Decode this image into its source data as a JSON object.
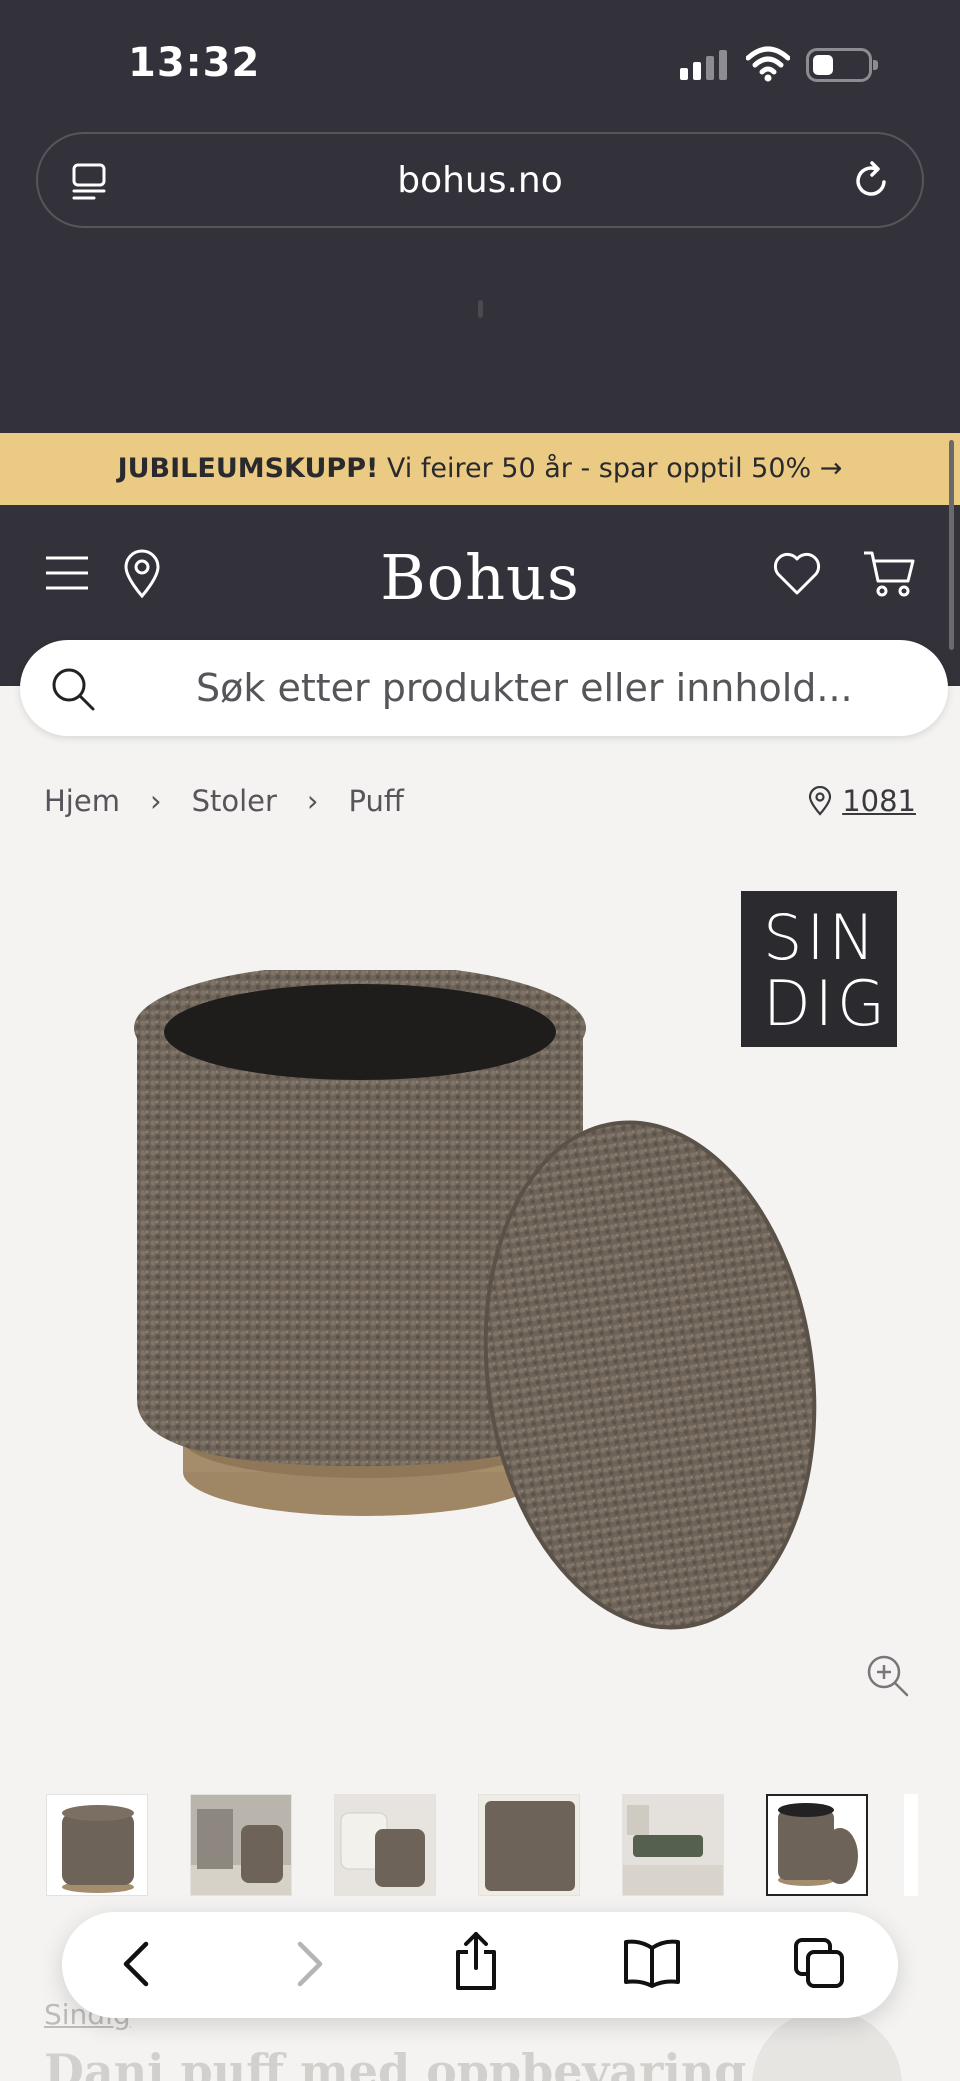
{
  "status_bar": {
    "time": "13:32"
  },
  "browser": {
    "url": "bohus.no"
  },
  "promo": {
    "bold": "JUBILEUMSKUPP!",
    "text": " Vi feirer 50 år - spar opptil 50% →"
  },
  "header": {
    "logo": "Bohus"
  },
  "search": {
    "placeholder": "Søk etter produkter eller innhold..."
  },
  "breadcrumb": {
    "items": [
      "Hjem",
      "Stoler",
      "Puff"
    ],
    "separator": "›"
  },
  "store": {
    "code": "1081"
  },
  "brand_badge": {
    "line1": "SIN",
    "line2": "DIG"
  },
  "product": {
    "brand": "Sindig",
    "title": "Dani puff med oppbevaring"
  },
  "thumbnails": {
    "count": 6,
    "active_index": 5
  },
  "icons": [
    "tab-icon",
    "reload-icon",
    "menu-icon",
    "location-pin-icon",
    "heart-icon",
    "cart-icon",
    "search-icon",
    "zoom-in-icon",
    "back-icon",
    "forward-icon",
    "share-icon",
    "bookmarks-icon",
    "tabs-icon"
  ],
  "colors": {
    "dark": "#33323a",
    "promo": "#ebcb84",
    "page_bg": "#f4f3f1"
  }
}
